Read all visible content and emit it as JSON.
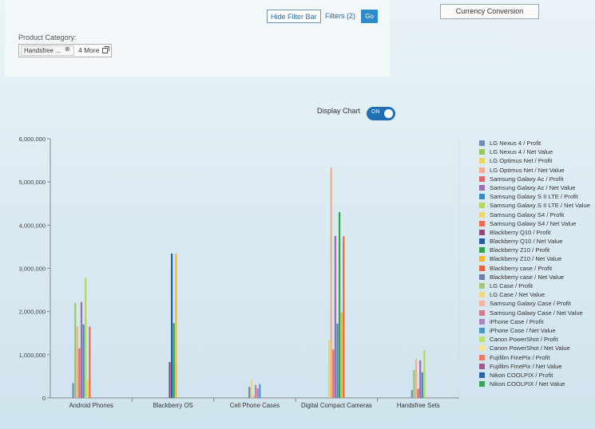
{
  "filter_bar": {
    "hide_label": "Hide Filter Bar",
    "filters_label": "Filters (2)",
    "go_label": "Go",
    "category_label": "Product Category:",
    "token_text": "Handsfree ...",
    "token_remove_icon": "close-circle-icon",
    "more_label": "4 More",
    "more_icon": "value-help-icon"
  },
  "currency_button": "Currency Conversion",
  "display_chart": {
    "label": "Display Chart",
    "toggle_state": "ON"
  },
  "chart_data": {
    "type": "bar",
    "categories": [
      "Android Phones",
      "Blackberry OS",
      "Cell Phone Cases",
      "Digital Compact Cameras",
      "Handsfree Sets"
    ],
    "ylim": [
      0,
      6000000
    ],
    "yticks": [
      "0",
      "1,000,000",
      "2,000,000",
      "3,000,000",
      "4,000,000",
      "5,000,000",
      "6,000,000"
    ],
    "grid": false,
    "legend_position": "right",
    "series": [
      {
        "name": "LG Nexus 4 / Profit",
        "color": "#6e8fb8",
        "values": [
          340000,
          0,
          0,
          0,
          180000
        ]
      },
      {
        "name": "LG Nexus 4 / Net Value",
        "color": "#98c765",
        "values": [
          2200000,
          0,
          0,
          0,
          650000
        ]
      },
      {
        "name": "LG Optimus Net / Profit",
        "color": "#f0d55a",
        "values": [
          0,
          0,
          0,
          1330000,
          0
        ]
      },
      {
        "name": "LG Optimus Net / Net Value",
        "color": "#f4ad8c",
        "values": [
          1650000,
          0,
          0,
          5330000,
          900000
        ]
      },
      {
        "name": "Samsung Galaxy Ac / Profit",
        "color": "#e06a6a",
        "values": [
          1150000,
          0,
          0,
          1120000,
          210000
        ]
      },
      {
        "name": "Samsung Galaxy Ac / Net Value",
        "color": "#9b6db5",
        "values": [
          2220000,
          0,
          0,
          3750000,
          870000
        ]
      },
      {
        "name": "Samsung Galaxy S II LTE / Profit",
        "color": "#3a8fbf",
        "values": [
          1700000,
          0,
          0,
          1720000,
          590000
        ]
      },
      {
        "name": "Samsung Galaxy S II LTE / Net Value",
        "color": "#b7d957",
        "values": [
          2780000,
          0,
          0,
          0,
          1100000
        ]
      },
      {
        "name": "Samsung Galaxy S4 / Profit",
        "color": "#f3d36b",
        "values": [
          420000,
          0,
          0,
          0,
          0
        ]
      },
      {
        "name": "Samsung Galaxy S4 / Net Value",
        "color": "#f06a4c",
        "values": [
          1650000,
          0,
          0,
          0,
          0
        ]
      },
      {
        "name": "Blackberry Q10 / Profit",
        "color": "#8b4b7f",
        "values": [
          0,
          830000,
          0,
          0,
          0
        ]
      },
      {
        "name": "Blackberry Q10 / Net Value",
        "color": "#1f5faa",
        "values": [
          0,
          3340000,
          0,
          0,
          0
        ]
      },
      {
        "name": "Blackberry Z10 / Profit",
        "color": "#2ea34a",
        "values": [
          0,
          1730000,
          0,
          4300000,
          0
        ]
      },
      {
        "name": "Blackberry Z10 / Net Value",
        "color": "#f4b533",
        "values": [
          0,
          3340000,
          0,
          1980000,
          0
        ]
      },
      {
        "name": "Blackberry case / Profit",
        "color": "#e8673a",
        "values": [
          0,
          0,
          0,
          3740000,
          0
        ]
      },
      {
        "name": "Blackberry case / Net Value",
        "color": "#6b7fa8",
        "values": [
          0,
          0,
          250000,
          0,
          0
        ]
      },
      {
        "name": "LG Case / Profit",
        "color": "#a3c77a",
        "values": [
          0,
          0,
          0,
          0,
          0
        ]
      },
      {
        "name": "LG Case / Net Value",
        "color": "#f2d87a",
        "values": [
          0,
          0,
          420000,
          0,
          0
        ]
      },
      {
        "name": "Samsung Galaxy Case / Profit",
        "color": "#f5b49a",
        "values": [
          0,
          0,
          60000,
          0,
          0
        ]
      },
      {
        "name": "Samsung Galaxy Case / Net Value",
        "color": "#d47a8a",
        "values": [
          0,
          0,
          300000,
          0,
          0
        ]
      },
      {
        "name": "iPhone Case / Profit",
        "color": "#a885c2",
        "values": [
          0,
          0,
          220000,
          0,
          0
        ]
      },
      {
        "name": "iPhone Case / Net Value",
        "color": "#4c98c8",
        "values": [
          0,
          0,
          320000,
          0,
          0
        ]
      },
      {
        "name": "Canon PowerShot / Profit",
        "color": "#c0df6a",
        "values": [
          0,
          0,
          0,
          0,
          0
        ]
      },
      {
        "name": "Canon PowerShot / Net Value",
        "color": "#f7e28e",
        "values": [
          0,
          0,
          0,
          0,
          0
        ]
      },
      {
        "name": "Fujifilm FinePix / Profit",
        "color": "#f07a60",
        "values": [
          0,
          0,
          0,
          0,
          0
        ]
      },
      {
        "name": "Fujifilm FinePix / Net Value",
        "color": "#9a5a8e",
        "values": [
          0,
          0,
          0,
          0,
          0
        ]
      },
      {
        "name": "Nikon COOLPIX / Profit",
        "color": "#2a66b0",
        "values": [
          0,
          0,
          0,
          0,
          0
        ]
      },
      {
        "name": "Nikon COOLPIX / Net Value",
        "color": "#34a655",
        "values": [
          0,
          0,
          0,
          0,
          0
        ]
      }
    ]
  }
}
